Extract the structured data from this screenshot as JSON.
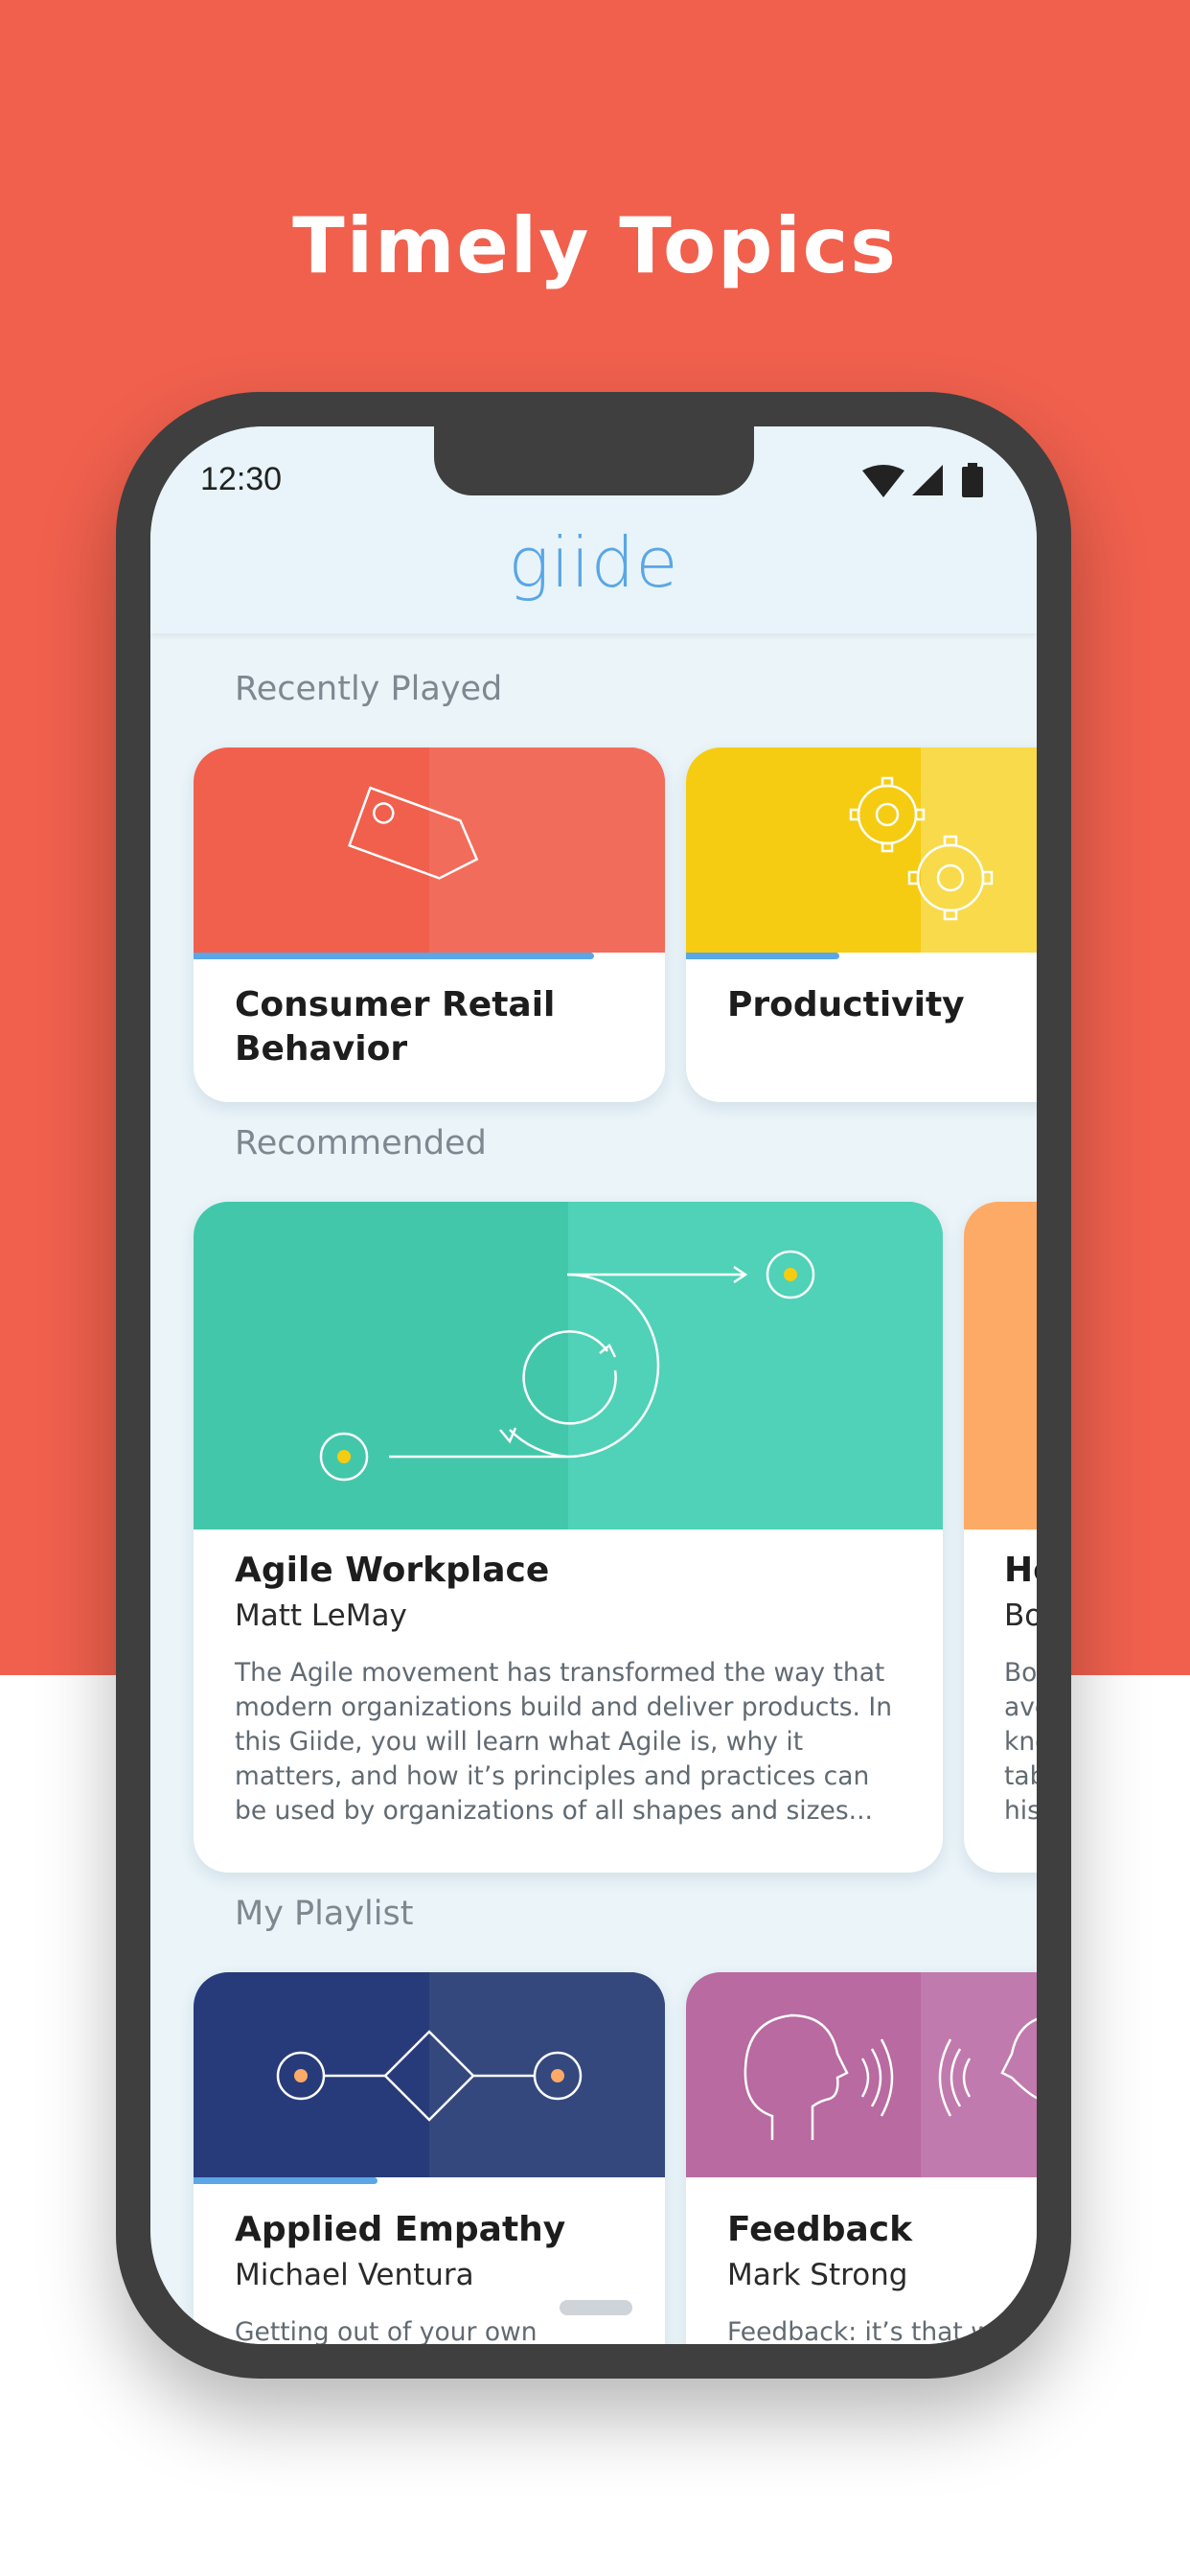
{
  "hero": {
    "title": "Timely Topics"
  },
  "status_bar": {
    "time": "12:30",
    "icons": [
      "wifi-icon",
      "signal-icon",
      "battery-icon"
    ]
  },
  "app": {
    "logo": "giide"
  },
  "colors": {
    "background": "#f0604d",
    "accent": "#5aa6e6",
    "retail": "#f0604d",
    "productivity": "#f5cc12",
    "agile": "#43c7ab",
    "orange": "#fdaa66",
    "empathy": "#273b7a",
    "feedback": "#b86aa1"
  },
  "recently_played": {
    "title": "Recently Played",
    "items": [
      {
        "title": "Consumer Retail Behavior",
        "icon": "price-tag-icon",
        "progress": 0.85
      },
      {
        "title": "Productivity",
        "icon": "gears-icon",
        "progress": 0.45
      }
    ]
  },
  "recommended": {
    "title": "Recommended",
    "items": [
      {
        "title": "Agile Workplace",
        "author": "Matt LeMay",
        "icon": "agile-loop-icon",
        "description": "The Agile movement has transformed the way that modern organizations build and deliver products. In this Giide, you will learn what Agile is, why it matters, and how it’s principles and practices can be used by organizations of all shapes and sizes..."
      },
      {
        "title": "He",
        "author": "Bo",
        "description_lines": [
          "Bo",
          "ave",
          "kno",
          "tab",
          "his"
        ]
      }
    ]
  },
  "playlist": {
    "title": "My Playlist",
    "items": [
      {
        "title": "Applied Empathy",
        "author": "Michael Ventura",
        "icon": "empathy-diagram-icon",
        "progress": 0.39,
        "description": "Getting out of your own"
      },
      {
        "title": "Feedback",
        "author": "Mark Strong",
        "icon": "speaking-heads-icon",
        "description": "Feedback: it’s that wo"
      }
    ]
  }
}
